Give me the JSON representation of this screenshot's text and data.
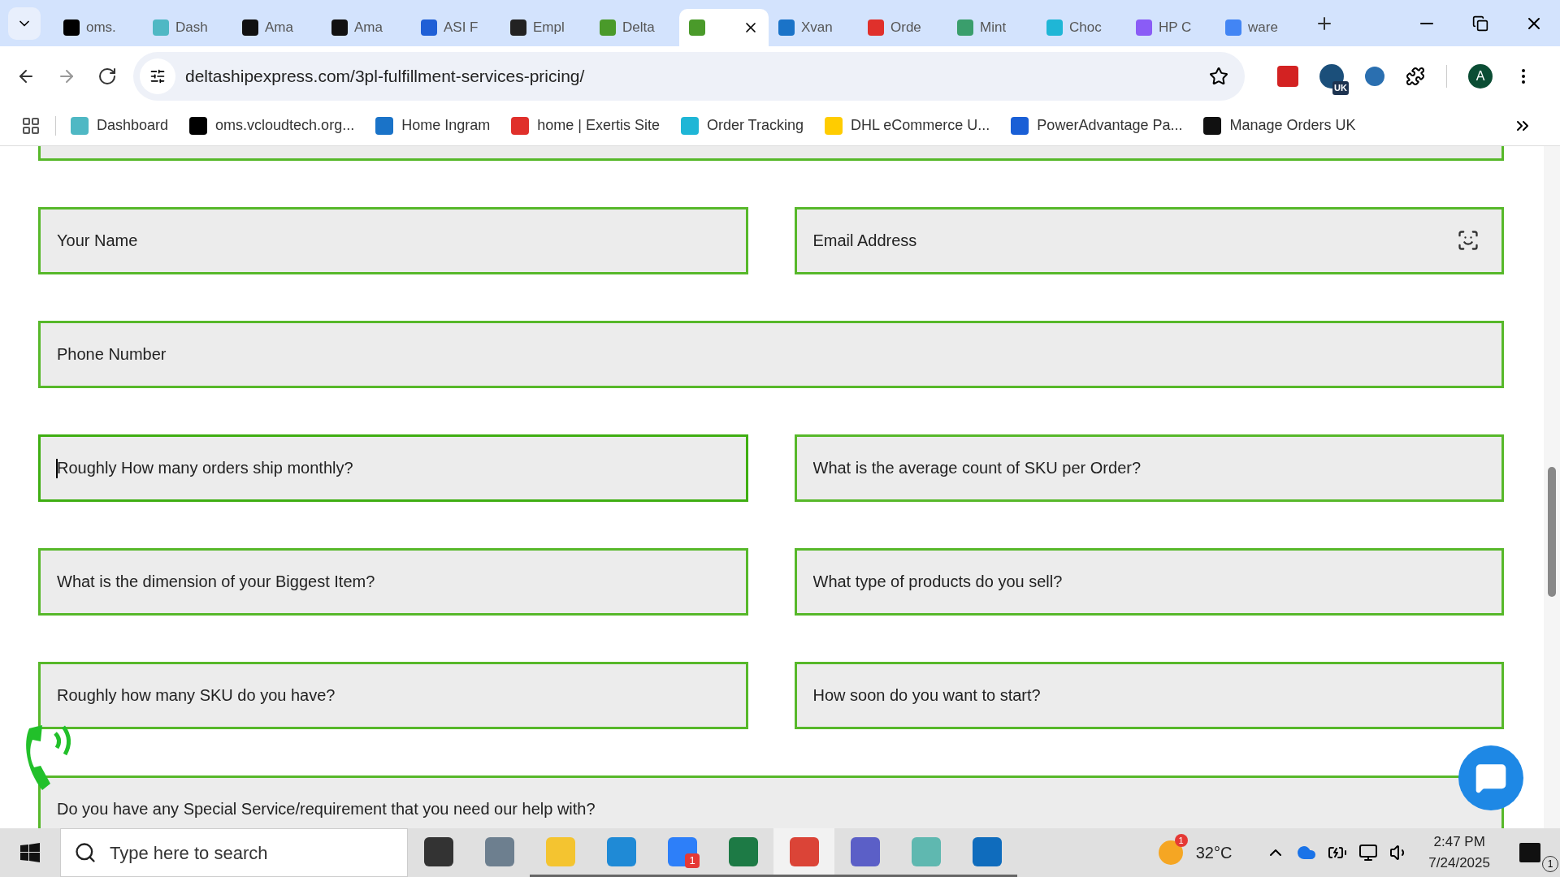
{
  "browser": {
    "tabs": [
      {
        "label": "oms.",
        "selected": false
      },
      {
        "label": "Dash",
        "selected": false
      },
      {
        "label": "Ama",
        "selected": false
      },
      {
        "label": "Ama",
        "selected": false
      },
      {
        "label": "ASI F",
        "selected": false
      },
      {
        "label": "Empl",
        "selected": false
      },
      {
        "label": "Delta",
        "selected": false
      },
      {
        "selected": true
      },
      {
        "label": "Xvan",
        "selected": false
      },
      {
        "label": "Orde",
        "selected": false
      },
      {
        "label": "Mint",
        "selected": false
      },
      {
        "label": "Choc",
        "selected": false
      },
      {
        "label": "HP C",
        "selected": false
      },
      {
        "label": "ware",
        "selected": false
      }
    ],
    "address": "deltashipexpress.com/3pl-fulfillment-services-pricing/",
    "profile_initial": "A",
    "extension_badge": "UK",
    "bookmarks": [
      "Dashboard",
      "oms.vcloudtech.org...",
      "Home Ingram",
      "home | Exertis Site",
      "Order Tracking",
      "DHL eCommerce U...",
      "PowerAdvantage Pa...",
      "Manage Orders UK"
    ]
  },
  "form": {
    "fields": [
      [
        {
          "placeholder": "Your Name",
          "focused": false
        },
        {
          "placeholder": "Email Address",
          "focused": false,
          "autofill_icon": true
        }
      ],
      [
        {
          "placeholder": "Phone Number",
          "focused": false
        }
      ],
      [
        {
          "placeholder": "Roughly How many orders ship monthly?",
          "focused": true
        },
        {
          "placeholder": "What is the average count of SKU per Order?",
          "focused": false
        }
      ],
      [
        {
          "placeholder": "What is the dimension of your Biggest Item?",
          "focused": false
        },
        {
          "placeholder": "What type of products do you sell?",
          "focused": false
        }
      ],
      [
        {
          "placeholder": "Roughly how many SKU do you have?",
          "focused": false
        },
        {
          "placeholder": "How soon do you want to start?",
          "focused": false
        }
      ],
      [
        {
          "placeholder": "Do you have any Special Service/requirement that you need our help with?",
          "focused": false
        }
      ]
    ]
  },
  "taskbar": {
    "search_placeholder": "Type here to search",
    "apps": [
      {
        "running": false
      },
      {
        "running": false
      },
      {
        "running": true
      },
      {
        "running": true
      },
      {
        "running": true,
        "badge": "1"
      },
      {
        "running": true
      },
      {
        "running": true,
        "selected": true
      },
      {
        "running": true
      },
      {
        "running": true
      },
      {
        "running": true
      }
    ],
    "weather_badge": "1",
    "temperature": "32°C",
    "time": "2:47 PM",
    "date": "7/24/2025",
    "notifications": "1"
  }
}
